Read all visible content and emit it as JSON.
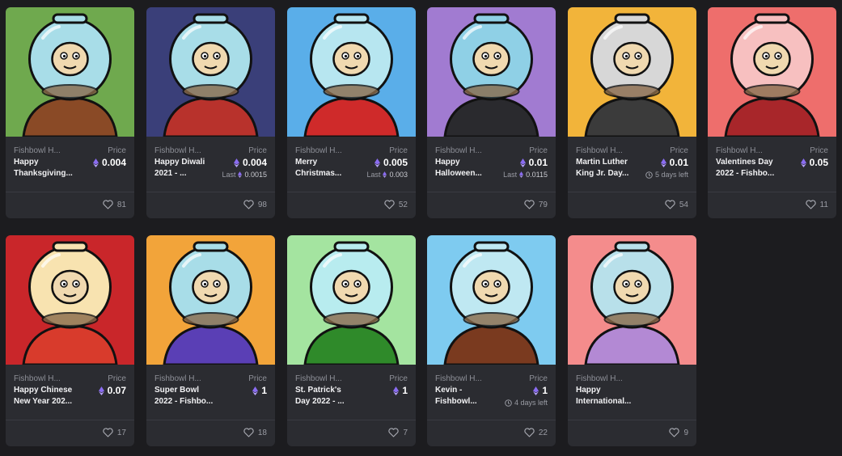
{
  "price_label": "Price",
  "cards": [
    {
      "collection": "Fishbowl H...",
      "name": "Happy\nThanksgiving...",
      "price": "0.004",
      "last_label": "",
      "last_value": "",
      "time_left": "",
      "likes": "81",
      "bg": "#6fa94e",
      "shirt": "#8a4a26",
      "glass": "#a8dde8"
    },
    {
      "collection": "Fishbowl H...",
      "name": "Happy Diwali\n2021 - ...",
      "price": "0.004",
      "last_label": "Last",
      "last_value": "0.0015",
      "time_left": "",
      "likes": "98",
      "bg": "#3a3f79",
      "shirt": "#b8322c",
      "glass": "#a8dde8"
    },
    {
      "collection": "Fishbowl H...",
      "name": "Merry\nChristmas...",
      "price": "0.005",
      "last_label": "Last",
      "last_value": "0.003",
      "time_left": "",
      "likes": "52",
      "bg": "#5aaee9",
      "shirt": "#cf2a2a",
      "glass": "#b7e6f0"
    },
    {
      "collection": "Fishbowl H...",
      "name": "Happy\nHalloween...",
      "price": "0.01",
      "last_label": "Last",
      "last_value": "0.0115",
      "time_left": "",
      "likes": "79",
      "bg": "#a17bd1",
      "shirt": "#2a2a2e",
      "glass": "#8fd0e6"
    },
    {
      "collection": "Fishbowl H...",
      "name": "Martin Luther\nKing Jr. Day...",
      "price": "0.01",
      "last_label": "",
      "last_value": "",
      "time_left": "5 days left",
      "likes": "54",
      "bg": "#f2b43a",
      "shirt": "#3b3b3b",
      "glass": "#d7d7d7"
    },
    {
      "collection": "Fishbowl H...",
      "name": "Valentines Day\n2022 - Fishbo...",
      "price": "0.05",
      "last_label": "",
      "last_value": "",
      "time_left": "",
      "likes": "11",
      "bg": "#ee6e6c",
      "shirt": "#a8262a",
      "glass": "#f7c0c0"
    },
    {
      "collection": "Fishbowl H...",
      "name": "Happy Chinese\nNew Year 202...",
      "price": "0.07",
      "last_label": "",
      "last_value": "",
      "time_left": "",
      "likes": "17",
      "bg": "#c9262a",
      "shirt": "#d83b2c",
      "glass": "#f8e3b0"
    },
    {
      "collection": "Fishbowl H...",
      "name": "Super Bowl\n2022 - Fishbo...",
      "price": "1",
      "last_label": "",
      "last_value": "",
      "time_left": "",
      "likes": "18",
      "bg": "#f2a43a",
      "shirt": "#5a3fb5",
      "glass": "#a8dde8"
    },
    {
      "collection": "Fishbowl H...",
      "name": "St. Patrick's\nDay 2022 - ...",
      "price": "1",
      "last_label": "",
      "last_value": "",
      "time_left": "",
      "likes": "7",
      "bg": "#a4e4a0",
      "shirt": "#2f8a2a",
      "glass": "#b8ecef"
    },
    {
      "collection": "Fishbowl H...",
      "name": "Kevin -\nFishbowl...",
      "price": "1",
      "last_label": "",
      "last_value": "",
      "time_left": "4 days left",
      "likes": "22",
      "bg": "#7ecbf0",
      "shirt": "#7a3a1f",
      "glass": "#bfe8f2"
    },
    {
      "collection": "Fishbowl H...",
      "name": "Happy\nInternational...",
      "price": "",
      "last_label": "",
      "last_value": "",
      "time_left": "",
      "likes": "9",
      "bg": "#f48c8c",
      "shirt": "#b389d4",
      "glass": "#b8e0ea"
    }
  ]
}
